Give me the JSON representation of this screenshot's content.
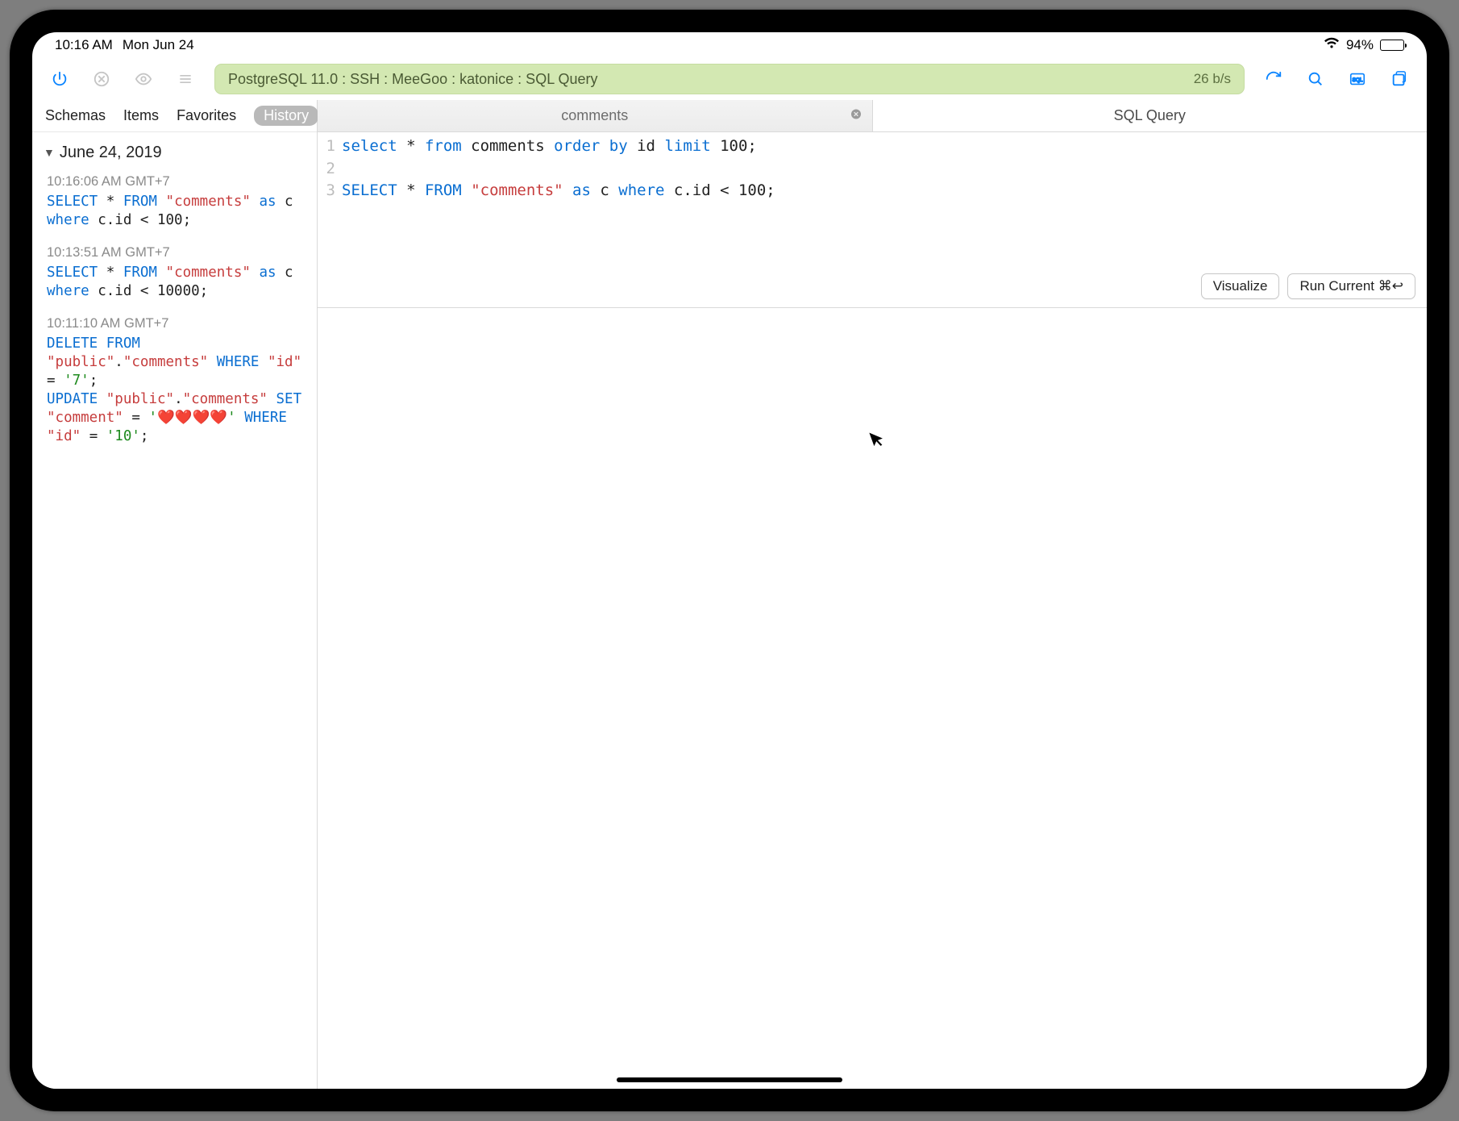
{
  "status": {
    "time": "10:16 AM",
    "date": "Mon Jun 24",
    "battery_pct": "94%"
  },
  "toolbar": {
    "connection": "PostgreSQL 11.0 : SSH : MeeGoo : katonice : SQL Query",
    "rate": "26 b/s"
  },
  "sidebar": {
    "tabs": {
      "schemas": "Schemas",
      "items": "Items",
      "favorites": "Favorites",
      "history": "History"
    },
    "date_header": "June 24, 2019",
    "entries": [
      {
        "time": "10:16:06 AM GMT+7",
        "tokens": [
          {
            "t": "SELECT",
            "c": "kw"
          },
          {
            "t": " * ",
            "c": "pl"
          },
          {
            "t": "FROM",
            "c": "kw"
          },
          {
            "t": " ",
            "c": "pl"
          },
          {
            "t": "\"comments\"",
            "c": "str"
          },
          {
            "t": " ",
            "c": "pl"
          },
          {
            "t": "as",
            "c": "kw"
          },
          {
            "t": " c ",
            "c": "pl"
          },
          {
            "t": "where",
            "c": "kw"
          },
          {
            "t": " c.id < 100;",
            "c": "pl"
          }
        ]
      },
      {
        "time": "10:13:51 AM GMT+7",
        "tokens": [
          {
            "t": "SELECT",
            "c": "kw"
          },
          {
            "t": " * ",
            "c": "pl"
          },
          {
            "t": "FROM",
            "c": "kw"
          },
          {
            "t": " ",
            "c": "pl"
          },
          {
            "t": "\"comments\"",
            "c": "str"
          },
          {
            "t": " ",
            "c": "pl"
          },
          {
            "t": "as",
            "c": "kw"
          },
          {
            "t": " c ",
            "c": "pl"
          },
          {
            "t": "where",
            "c": "kw"
          },
          {
            "t": " c.id < 10000;",
            "c": "pl"
          }
        ]
      },
      {
        "time": "10:11:10 AM GMT+7",
        "tokens": [
          {
            "t": "DELETE",
            "c": "kw"
          },
          {
            "t": " ",
            "c": "pl"
          },
          {
            "t": "FROM",
            "c": "kw"
          },
          {
            "t": " ",
            "c": "pl"
          },
          {
            "t": "\"public\"",
            "c": "str"
          },
          {
            "t": ".",
            "c": "pl"
          },
          {
            "t": "\"comments\"",
            "c": "str"
          },
          {
            "t": " ",
            "c": "pl"
          },
          {
            "t": "WHERE",
            "c": "kw"
          },
          {
            "t": " ",
            "c": "pl"
          },
          {
            "t": "\"id\"",
            "c": "str"
          },
          {
            "t": " = ",
            "c": "pl"
          },
          {
            "t": "'7'",
            "c": "strg"
          },
          {
            "t": ";\n",
            "c": "pl"
          },
          {
            "t": "UPDATE",
            "c": "kw"
          },
          {
            "t": " ",
            "c": "pl"
          },
          {
            "t": "\"public\"",
            "c": "str"
          },
          {
            "t": ".",
            "c": "pl"
          },
          {
            "t": "\"comments\"",
            "c": "str"
          },
          {
            "t": " ",
            "c": "pl"
          },
          {
            "t": "SET",
            "c": "kw"
          },
          {
            "t": " ",
            "c": "pl"
          },
          {
            "t": "\"comment\"",
            "c": "str"
          },
          {
            "t": " = ",
            "c": "pl"
          },
          {
            "t": "'❤️❤️❤️❤️'",
            "c": "strg"
          },
          {
            "t": " ",
            "c": "pl"
          },
          {
            "t": "WHERE",
            "c": "kw"
          },
          {
            "t": " ",
            "c": "pl"
          },
          {
            "t": "\"id\"",
            "c": "str"
          },
          {
            "t": " = ",
            "c": "pl"
          },
          {
            "t": "'10'",
            "c": "strg"
          },
          {
            "t": ";",
            "c": "pl"
          }
        ]
      }
    ]
  },
  "tabs": {
    "left": "comments",
    "right": "SQL Query"
  },
  "editor": {
    "lines": [
      [
        {
          "t": "select",
          "c": "kw"
        },
        {
          "t": " * ",
          "c": "pl"
        },
        {
          "t": "from",
          "c": "kw"
        },
        {
          "t": " comments ",
          "c": "pl"
        },
        {
          "t": "order",
          "c": "kw"
        },
        {
          "t": " ",
          "c": "pl"
        },
        {
          "t": "by",
          "c": "kw"
        },
        {
          "t": " id ",
          "c": "pl"
        },
        {
          "t": "limit",
          "c": "kw"
        },
        {
          "t": " 100;",
          "c": "pl"
        }
      ],
      [],
      [
        {
          "t": "SELECT",
          "c": "kw"
        },
        {
          "t": " * ",
          "c": "pl"
        },
        {
          "t": "FROM",
          "c": "kw"
        },
        {
          "t": " ",
          "c": "pl"
        },
        {
          "t": "\"comments\"",
          "c": "str"
        },
        {
          "t": " ",
          "c": "pl"
        },
        {
          "t": "as",
          "c": "kw"
        },
        {
          "t": " c ",
          "c": "pl"
        },
        {
          "t": "where",
          "c": "kw"
        },
        {
          "t": " c.id < 100;",
          "c": "pl"
        }
      ]
    ]
  },
  "actions": {
    "visualize": "Visualize",
    "run": "Run Current ⌘↩︎"
  }
}
